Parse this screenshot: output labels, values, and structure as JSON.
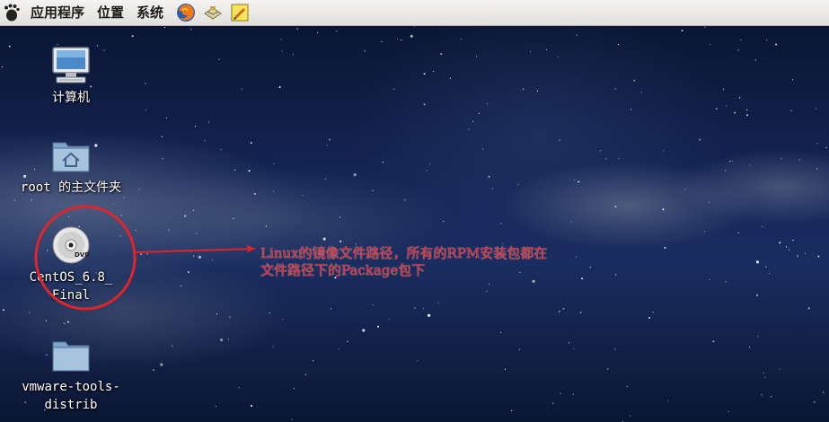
{
  "panel": {
    "menus": [
      "应用程序",
      "位置",
      "系统"
    ],
    "launchers": [
      "firefox-icon",
      "mail-icon",
      "notes-icon"
    ]
  },
  "desktop": {
    "icons": [
      {
        "label": "计算机",
        "icon": "computer-icon"
      },
      {
        "label": "root 的主文件夹",
        "icon": "home-folder-icon"
      },
      {
        "label": "CentOS_6.8_\nFinal",
        "icon": "dvd-icon",
        "badge": "DVD"
      },
      {
        "label": "vmware-tools-\ndistrib",
        "icon": "folder-icon"
      }
    ],
    "annotation": "Linux的镜像文件路径，所有的RPM安装包都在文件路径下的Package包下"
  },
  "colors": {
    "annotation": "#e0242a",
    "panel": "#ecebe8",
    "sky": "#0d1a3a"
  }
}
